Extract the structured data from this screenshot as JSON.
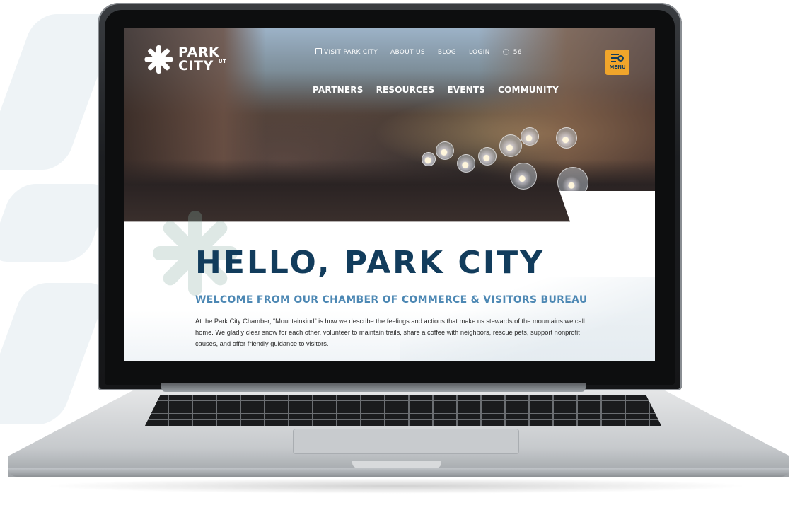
{
  "site": {
    "logo_line1": "PARK",
    "logo_line2": "CITY",
    "logo_suffix": "UT"
  },
  "top_nav": {
    "visit_label": "VISIT PARK CITY",
    "about_label": "ABOUT US",
    "blog_label": "BLOG",
    "login_label": "LOGIN",
    "temperature": "56"
  },
  "main_nav": [
    "PARTNERS",
    "RESOURCES",
    "EVENTS",
    "COMMUNITY"
  ],
  "menu_button": {
    "label": "MENU",
    "color": "#f0a52b"
  },
  "hero": {
    "headline": "HELLO, PARK CITY",
    "subheadline": "WELCOME FROM OUR CHAMBER OF COMMERCE & VISITORS BUREAU",
    "intro": "At the Park City Chamber, “Mountainkind” is how we describe the feelings and actions that make us stewards of the mountains we call home. We gladly clear snow for each other, volunteer to maintain trails, share a coffee with neighbors, rescue pets, support nonprofit causes, and offer friendly guidance to visitors."
  },
  "colors": {
    "navy": "#123c5c",
    "subhead_blue": "#4d88b4"
  }
}
